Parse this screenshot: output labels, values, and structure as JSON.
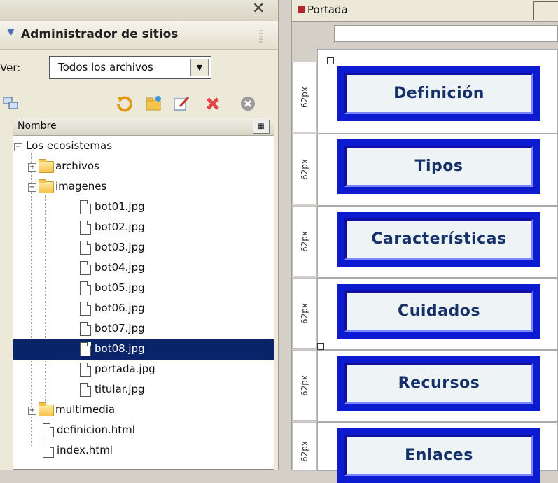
{
  "site_manager": {
    "title": "Administrador de sitios",
    "view_label": "Ver:",
    "view_value": "Todos los archivos",
    "column_header": "Nombre",
    "toolbar_icons": [
      "connect-icon",
      "refresh-icon",
      "new-folder-icon",
      "edit-icon",
      "delete-icon",
      "close-circle-icon"
    ],
    "tree": [
      {
        "name": "Los ecosistemas",
        "type": "root",
        "expanded": true
      },
      {
        "name": "archivos",
        "type": "folder",
        "expanded": false
      },
      {
        "name": "imagenes",
        "type": "folder",
        "expanded": true
      },
      {
        "name": "bot01.jpg",
        "type": "file"
      },
      {
        "name": "bot02.jpg",
        "type": "file"
      },
      {
        "name": "bot03.jpg",
        "type": "file"
      },
      {
        "name": "bot04.jpg",
        "type": "file"
      },
      {
        "name": "bot05.jpg",
        "type": "file"
      },
      {
        "name": "bot06.jpg",
        "type": "file"
      },
      {
        "name": "bot07.jpg",
        "type": "file"
      },
      {
        "name": "bot08.jpg",
        "type": "file",
        "selected": true
      },
      {
        "name": "portada.jpg",
        "type": "file"
      },
      {
        "name": "titular.jpg",
        "type": "file"
      },
      {
        "name": "multimedia",
        "type": "folder",
        "expanded": false
      },
      {
        "name": "definicion.html",
        "type": "file"
      },
      {
        "name": "index.html",
        "type": "file"
      }
    ]
  },
  "document": {
    "tab_name": "Portada",
    "row_height_label": "62px",
    "buttons": [
      "Definición",
      "Tipos",
      "Características",
      "Cuidados",
      "Recursos",
      "Enlaces"
    ]
  },
  "colors": {
    "selection": "#0a246a",
    "button_outer": "#0d1bd0",
    "button_face": "#eef4f6",
    "button_text": "#16306a"
  }
}
